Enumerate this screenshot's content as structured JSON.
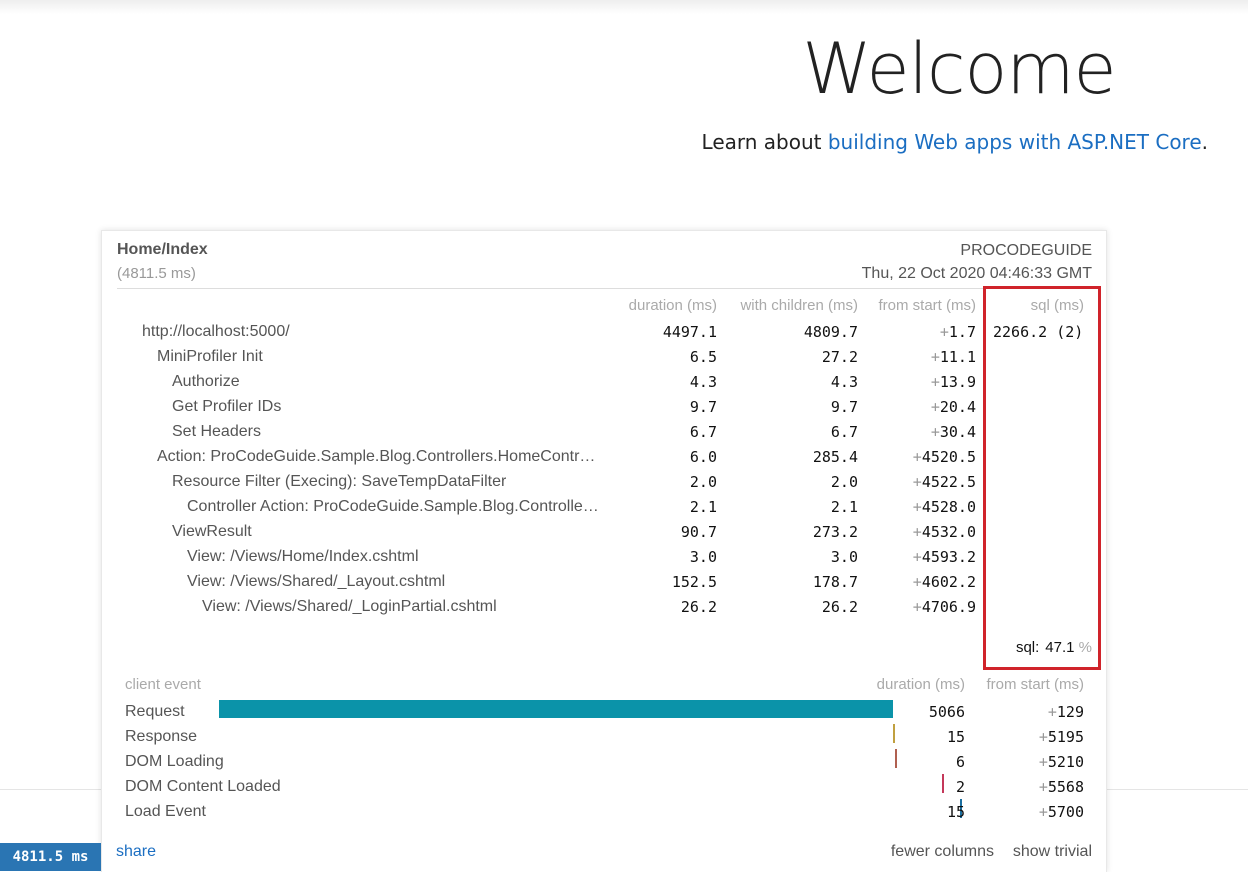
{
  "page": {
    "heading": "Welcome",
    "learn_prefix": "Learn about ",
    "learn_link": "building Web apps with ASP.NET Core",
    "learn_suffix": "."
  },
  "profiler": {
    "title": "Home/Index",
    "total": "(4811.5 ms)",
    "machine": "PROCODEGUIDE",
    "timestamp": "Thu, 22 Oct 2020 04:46:33 GMT",
    "columns": {
      "duration": "duration (ms)",
      "with_children": "with children (ms)",
      "from_start": "from start (ms)",
      "sql": "sql (ms)"
    },
    "timings": [
      {
        "name": "http://localhost:5000/",
        "depth": 0,
        "duration": "4497.1",
        "with_children": "4809.7",
        "from_start": "1.7",
        "sql": "2266.2 (2)"
      },
      {
        "name": "MiniProfiler Init",
        "depth": 1,
        "duration": "6.5",
        "with_children": "27.2",
        "from_start": "11.1",
        "sql": ""
      },
      {
        "name": "Authorize",
        "depth": 2,
        "duration": "4.3",
        "with_children": "4.3",
        "from_start": "13.9",
        "sql": ""
      },
      {
        "name": "Get Profiler IDs",
        "depth": 2,
        "duration": "9.7",
        "with_children": "9.7",
        "from_start": "20.4",
        "sql": ""
      },
      {
        "name": "Set Headers",
        "depth": 2,
        "duration": "6.7",
        "with_children": "6.7",
        "from_start": "30.4",
        "sql": ""
      },
      {
        "name": "Action: ProCodeGuide.Sample.Blog.Controllers.HomeController.Index (ProCodeGuide.Sample.Blog)",
        "depth": 1,
        "duration": "6.0",
        "with_children": "285.4",
        "from_start": "4520.5",
        "sql": ""
      },
      {
        "name": "Resource Filter (Execing): SaveTempDataFilter",
        "depth": 2,
        "duration": "2.0",
        "with_children": "2.0",
        "from_start": "4522.5",
        "sql": ""
      },
      {
        "name": "Controller Action: ProCodeGuide.Sample.Blog.Controllers.HomeController.Index",
        "depth": 3,
        "duration": "2.1",
        "with_children": "2.1",
        "from_start": "4528.0",
        "sql": ""
      },
      {
        "name": "ViewResult",
        "depth": 2,
        "duration": "90.7",
        "with_children": "273.2",
        "from_start": "4532.0",
        "sql": ""
      },
      {
        "name": "View: /Views/Home/Index.cshtml",
        "depth": 3,
        "duration": "3.0",
        "with_children": "3.0",
        "from_start": "4593.2",
        "sql": ""
      },
      {
        "name": "View: /Views/Shared/_Layout.cshtml",
        "depth": 3,
        "duration": "152.5",
        "with_children": "178.7",
        "from_start": "4602.2",
        "sql": ""
      },
      {
        "name": "View: /Views/Shared/_LoginPartial.cshtml",
        "depth": 4,
        "duration": "26.2",
        "with_children": "26.2",
        "from_start": "4706.9",
        "sql": ""
      }
    ],
    "sql_summary": {
      "label": "sql:",
      "value": "47.1",
      "unit": "%"
    },
    "client_columns": {
      "event": "client event",
      "duration": "duration (ms)",
      "from_start": "from start (ms)"
    },
    "client_events": [
      {
        "name": "Request",
        "duration": 5066,
        "from_start": 129,
        "color": "#0b93a9"
      },
      {
        "name": "Response",
        "duration": 15,
        "from_start": 5195,
        "color": "#c0a040"
      },
      {
        "name": "DOM Loading",
        "duration": 6,
        "from_start": 5210,
        "color": "#b06050"
      },
      {
        "name": "DOM Content Loaded",
        "duration": 2,
        "from_start": 5568,
        "color": "#c4385a"
      },
      {
        "name": "Load Event",
        "duration": 15,
        "from_start": 5700,
        "color": "#1b6fa0"
      }
    ],
    "footer": {
      "share": "share",
      "fewer_columns": "fewer columns",
      "show_trivial": "show trivial"
    },
    "badge": "4811.5 ms"
  },
  "colors": {
    "link": "#1b6ec2",
    "highlight": "#d0232a",
    "badge": "#2a75b3"
  }
}
